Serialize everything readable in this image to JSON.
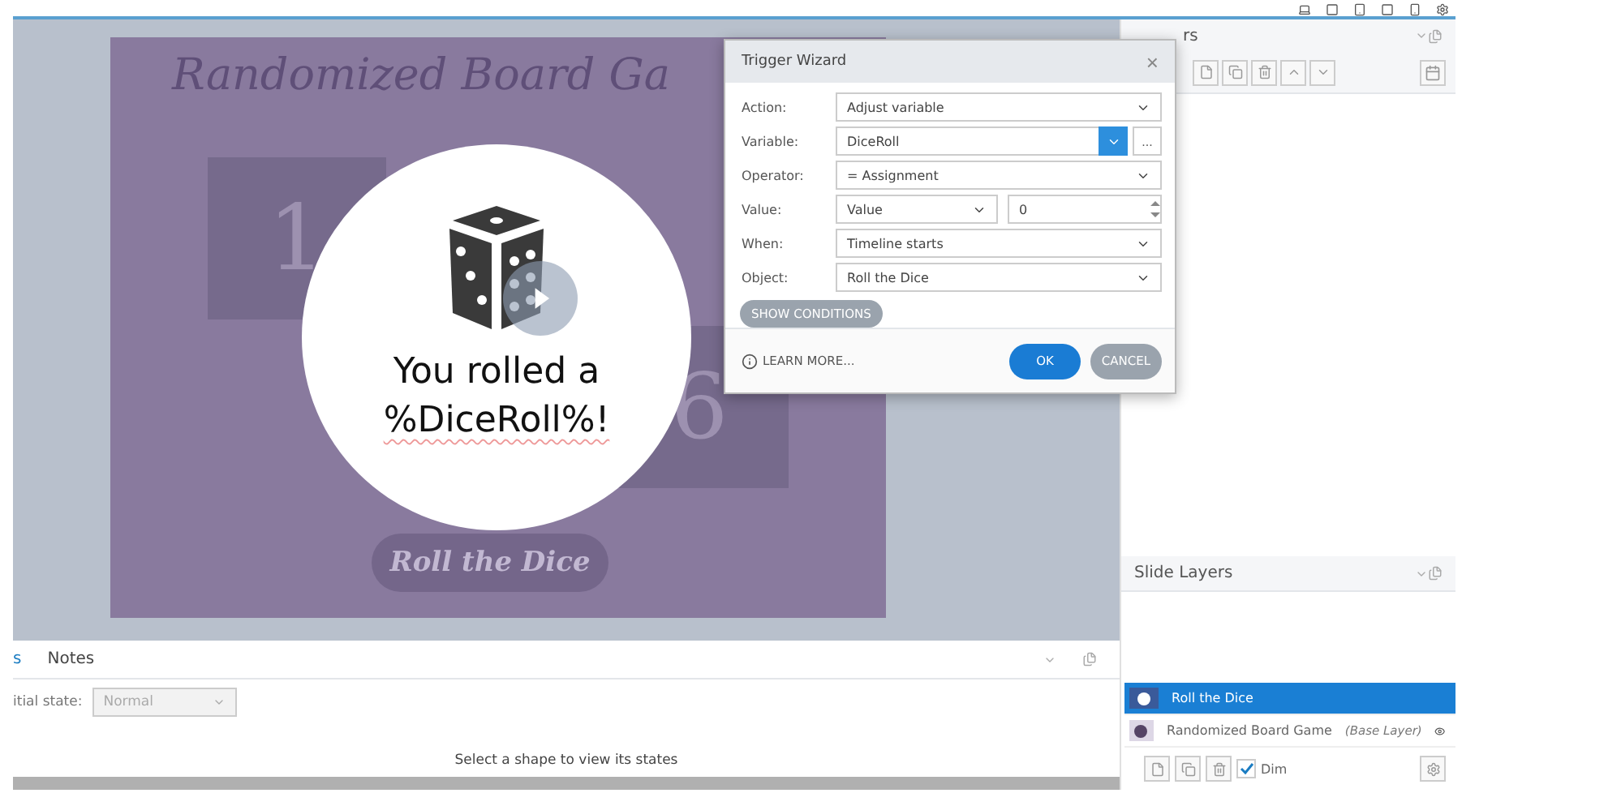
{
  "slide": {
    "title": "Randomized Board Ga",
    "tiles": [
      {
        "label": "1"
      },
      {
        "label": "6"
      }
    ],
    "popup": {
      "lines": [
        "You rolled a",
        "%DiceRoll%!"
      ]
    },
    "button": "Roll the Dice"
  },
  "dialog": {
    "title": "Trigger Wizard",
    "close": "×",
    "fields": [
      {
        "kind": "select",
        "label": "Action:",
        "value": "Adjust variable"
      },
      {
        "kind": "variable",
        "label": "Variable:",
        "value": "DiceRoll",
        "more": "..."
      },
      {
        "kind": "select",
        "label": "Operator:",
        "value": "= Assignment"
      },
      {
        "kind": "value",
        "label": "Value:",
        "value": "Value",
        "number": "0"
      },
      {
        "kind": "select",
        "label": "When:",
        "value": "Timeline starts"
      },
      {
        "kind": "select",
        "label": "Object:",
        "value": "Roll the Dice"
      }
    ],
    "show_conditions": "SHOW CONDITIONS",
    "learn_more": "LEARN MORE...",
    "ok": "OK",
    "cancel": "CANCEL"
  },
  "triggers_panel": {
    "title": "rs"
  },
  "bottom_panel": {
    "tabs": [
      {
        "label": "s",
        "selected": true
      },
      {
        "label": "Notes",
        "selected": false
      }
    ],
    "initial_state_label": "itial state:",
    "initial_state": "Normal",
    "message": "Select a shape to view its states"
  },
  "layers_panel": {
    "title": "Slide Layers",
    "layers": [
      {
        "name": "Roll the Dice",
        "selected": true
      },
      {
        "name": "Randomized Board Game",
        "selected": false,
        "note": "(Base Layer)"
      }
    ],
    "dim": {
      "label": "Dim",
      "checked": true
    }
  }
}
